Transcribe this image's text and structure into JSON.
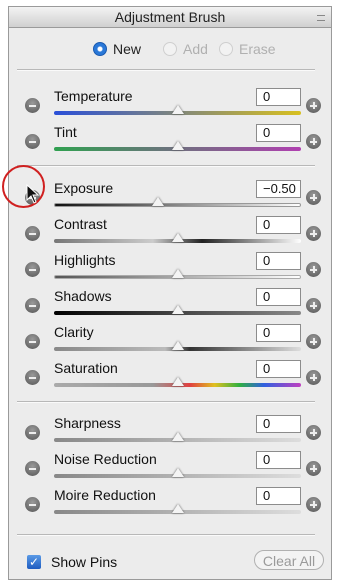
{
  "panel": {
    "title": "Adjustment Brush",
    "modes": [
      {
        "label": "New",
        "selected": true
      },
      {
        "label": "Add",
        "selected": false
      },
      {
        "label": "Erase",
        "selected": false
      }
    ]
  },
  "sliders": [
    {
      "label": "Temperature",
      "value": "0",
      "level": 0.5
    },
    {
      "label": "Tint",
      "value": "0",
      "level": 0.5
    },
    {
      "label": "Exposure",
      "value": "−0.50",
      "level": 0.42
    },
    {
      "label": "Contrast",
      "value": "0",
      "level": 0.5
    },
    {
      "label": "Highlights",
      "value": "0",
      "level": 0.5
    },
    {
      "label": "Shadows",
      "value": "0",
      "level": 0.5
    },
    {
      "label": "Clarity",
      "value": "0",
      "level": 0.5
    },
    {
      "label": "Saturation",
      "value": "0",
      "level": 0.5
    },
    {
      "label": "Sharpness",
      "value": "0",
      "level": 0.5
    },
    {
      "label": "Noise Reduction",
      "value": "0",
      "level": 0.5
    },
    {
      "label": "Moire Reduction",
      "value": "0",
      "level": 0.5
    }
  ],
  "footer": {
    "show_pins_label": "Show Pins",
    "show_pins_checked": true,
    "clear_all_label": "Clear All"
  },
  "colors": {
    "accent": "#2a78d8",
    "annotation": "#d02020"
  }
}
